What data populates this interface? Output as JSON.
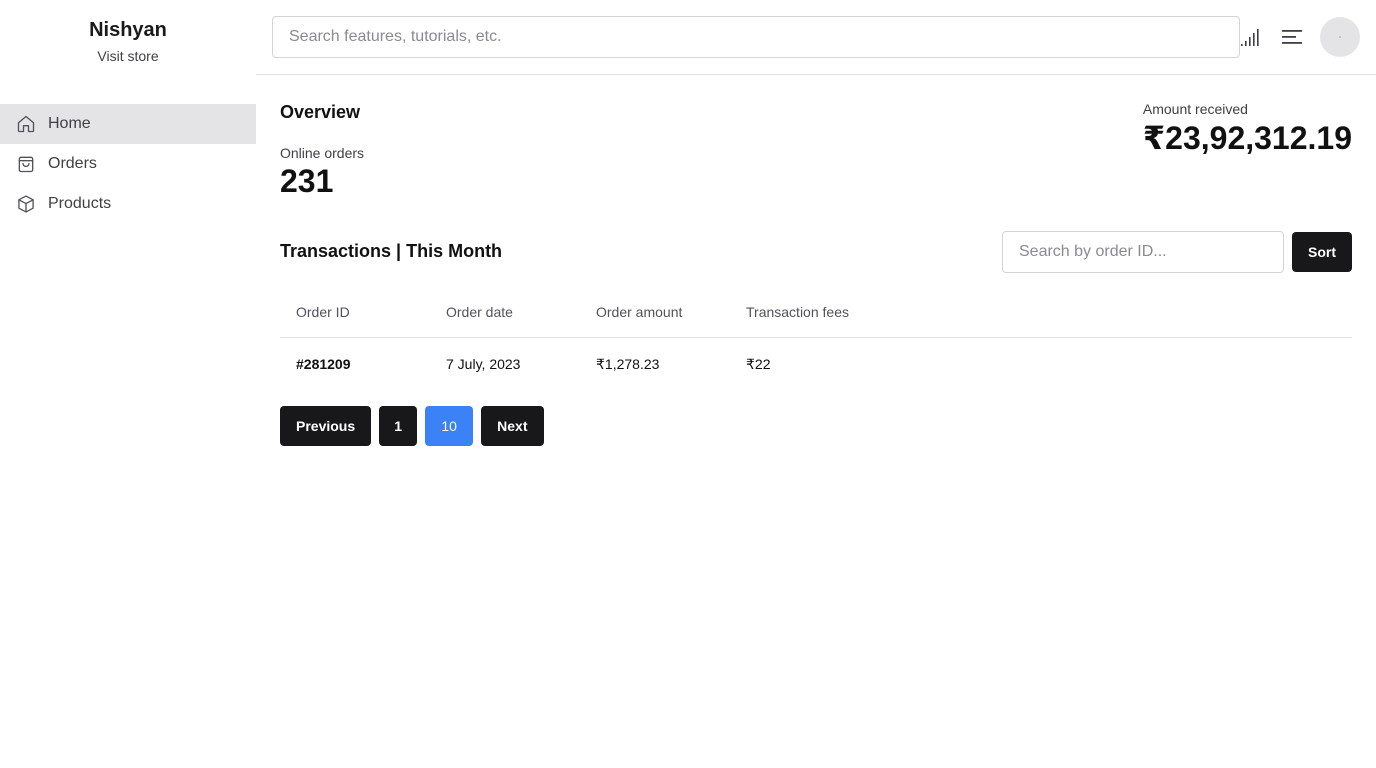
{
  "brand": {
    "name": "Nishyan",
    "link_label": "Visit store"
  },
  "sidebar": {
    "items": [
      {
        "label": "Home",
        "icon": "home-icon",
        "active": true
      },
      {
        "label": "Orders",
        "icon": "shopping-bag-icon",
        "active": false
      },
      {
        "label": "Products",
        "icon": "package-icon",
        "active": false
      }
    ]
  },
  "header": {
    "search_placeholder": "Search features, tutorials, etc.",
    "search_value": "",
    "icons": [
      "signal-icon",
      "menu-icon",
      "avatar"
    ]
  },
  "overview": {
    "title": "Overview",
    "online_orders_label": "Online orders",
    "online_orders_value": "231",
    "amount_received_label": "Amount received",
    "amount_received_value": "₹23,92,312.19"
  },
  "transactions": {
    "title": "Transactions | This Month",
    "search_placeholder": "Search by order ID...",
    "search_value": "",
    "sort_label": "Sort",
    "columns": [
      "Order ID",
      "Order date",
      "Order amount",
      "Transaction fees"
    ],
    "rows": [
      {
        "order_id": "#281209",
        "order_date": "7 July, 2023",
        "order_amount": "₹1,278.23",
        "transaction_fees": "₹22"
      }
    ]
  },
  "pagination": {
    "previous_label": "Previous",
    "pages": [
      "1",
      "10"
    ],
    "current_page": "10",
    "next_label": "Next"
  },
  "colors": {
    "primary_button": "#18181b",
    "active_page": "#3b82f6",
    "active_nav_bg": "#e4e4e7",
    "border": "#e4e4e7"
  }
}
